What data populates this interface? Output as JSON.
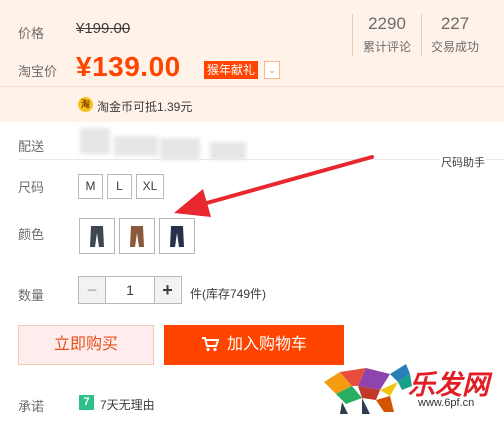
{
  "price": {
    "label": "价格",
    "original": "¥199.00"
  },
  "promo": {
    "label": "淘宝价",
    "price": "¥139.00",
    "tag": "猴年献礼",
    "caret": "⌄"
  },
  "stats": [
    {
      "value": "2290",
      "label": "累计评论"
    },
    {
      "value": "227",
      "label": "交易成功"
    }
  ],
  "coin": {
    "icon_text": "淘",
    "text": "淘金币可抵1.39元"
  },
  "delivery": {
    "label": "配送",
    "size_helper": "尺码助手"
  },
  "size": {
    "label": "尺码",
    "options": [
      "M",
      "L",
      "XL"
    ]
  },
  "color": {
    "label": "颜色",
    "swatch_colors": [
      "#3f4652",
      "#8b5a3c",
      "#27324a"
    ]
  },
  "quantity": {
    "label": "数量",
    "minus": "−",
    "value": "1",
    "plus": "+",
    "stock_text": "件(库存749件)"
  },
  "actions": {
    "buy_now": "立即购买",
    "add_cart": "加入购物车"
  },
  "promise": {
    "label": "承诺",
    "badge": "7",
    "text": "7天无理由"
  },
  "watermark": {
    "title": "乐发网",
    "url": "www.6pf.cn"
  },
  "colors": {
    "accent": "#ff4400",
    "panel_bg": "#fff2e8",
    "arrow": "#e8272f"
  }
}
